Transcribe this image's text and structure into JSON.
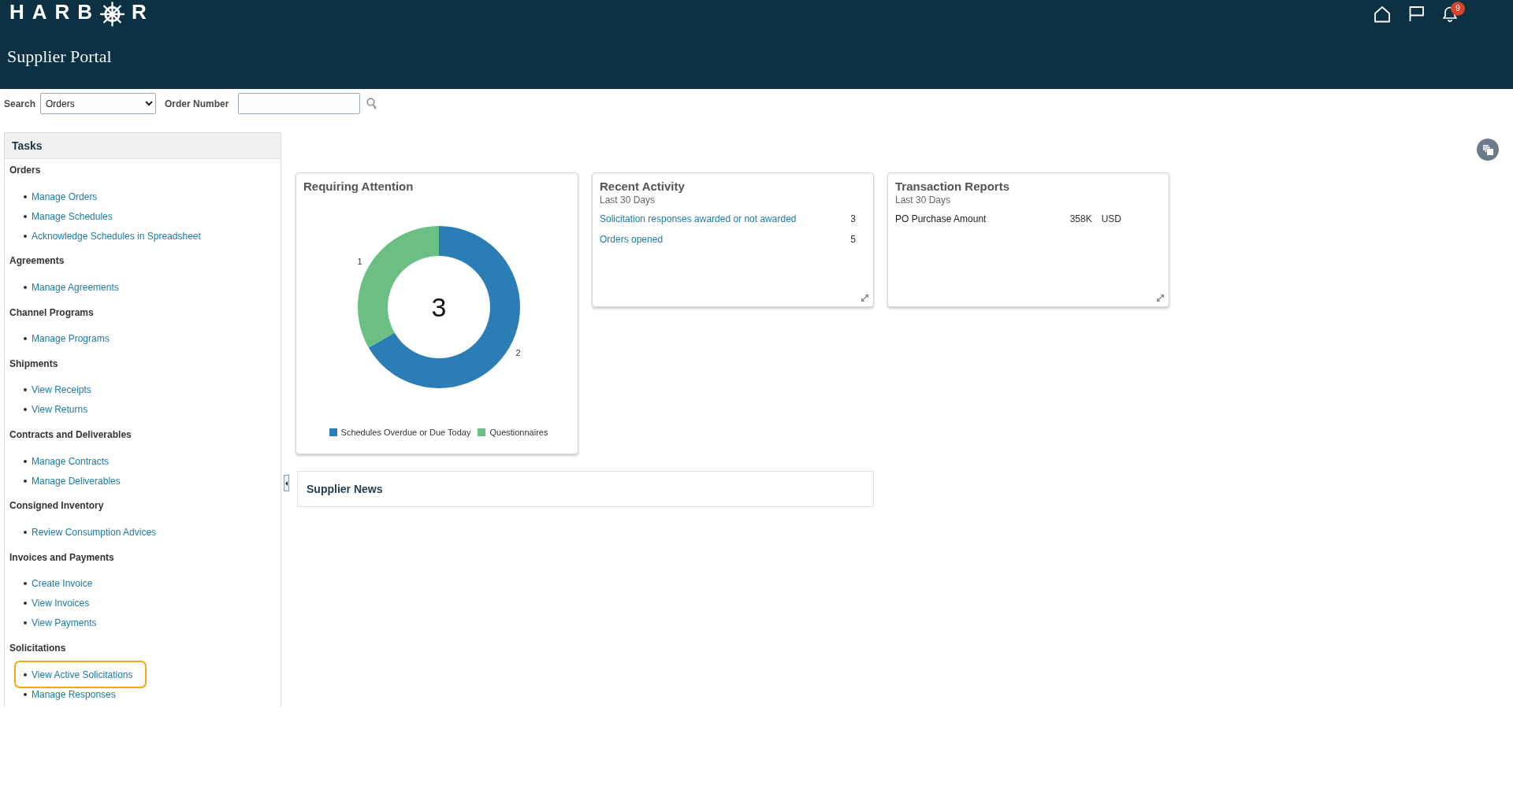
{
  "header": {
    "logo": {
      "text_start": "HARB",
      "text_end": "R"
    },
    "title": "Supplier Portal",
    "notification_count": "9"
  },
  "search": {
    "label": "Search",
    "category": "Orders",
    "field_label": "Order Number"
  },
  "tasks": {
    "title": "Tasks",
    "groups": [
      {
        "title": "Orders",
        "items": [
          {
            "label": "Manage Orders",
            "highlighted": false
          },
          {
            "label": "Manage Schedules",
            "highlighted": false
          },
          {
            "label": "Acknowledge Schedules in Spreadsheet",
            "highlighted": false
          }
        ]
      },
      {
        "title": "Agreements",
        "items": [
          {
            "label": "Manage Agreements",
            "highlighted": false
          }
        ]
      },
      {
        "title": "Channel Programs",
        "items": [
          {
            "label": "Manage Programs",
            "highlighted": false
          }
        ]
      },
      {
        "title": "Shipments",
        "items": [
          {
            "label": "View Receipts",
            "highlighted": false
          },
          {
            "label": "View Returns",
            "highlighted": false
          }
        ]
      },
      {
        "title": "Contracts and Deliverables",
        "items": [
          {
            "label": "Manage Contracts",
            "highlighted": false
          },
          {
            "label": "Manage Deliverables",
            "highlighted": false
          }
        ]
      },
      {
        "title": "Consigned Inventory",
        "items": [
          {
            "label": "Review Consumption Advices",
            "highlighted": false
          }
        ]
      },
      {
        "title": "Invoices and Payments",
        "items": [
          {
            "label": "Create Invoice",
            "highlighted": false
          },
          {
            "label": "View Invoices",
            "highlighted": false
          },
          {
            "label": "View Payments",
            "highlighted": false
          }
        ]
      },
      {
        "title": "Solicitations",
        "items": [
          {
            "label": "View Active Solicitations",
            "highlighted": true
          },
          {
            "label": "Manage Responses",
            "highlighted": false
          }
        ]
      }
    ]
  },
  "cards": [
    {
      "kind": "chart",
      "title": "Requiring Attention",
      "center_text": "3",
      "chart_data": {
        "type": "donut",
        "categories": [
          "Schedules Overdue or Due Today",
          "Questionnaires"
        ],
        "values": [
          2,
          1
        ],
        "colors": [
          "#2a7db5",
          "#6bbf84"
        ],
        "data_labels": true
      }
    },
    {
      "kind": "list",
      "title": "Recent Activity",
      "subtitle": "Last 30 Days",
      "rows": [
        {
          "kind": "link",
          "label": "Solicitation responses awarded or not awarded",
          "value": "3"
        },
        {
          "kind": "link",
          "label": "Orders opened",
          "value": "5"
        }
      ]
    },
    {
      "kind": "list",
      "title": "Transaction Reports",
      "subtitle": "Last 30 Days",
      "rows": [
        {
          "kind": "text",
          "label": "PO Purchase Amount",
          "value": "358K",
          "unit": "USD"
        }
      ]
    }
  ],
  "news": {
    "title": "Supplier News"
  }
}
